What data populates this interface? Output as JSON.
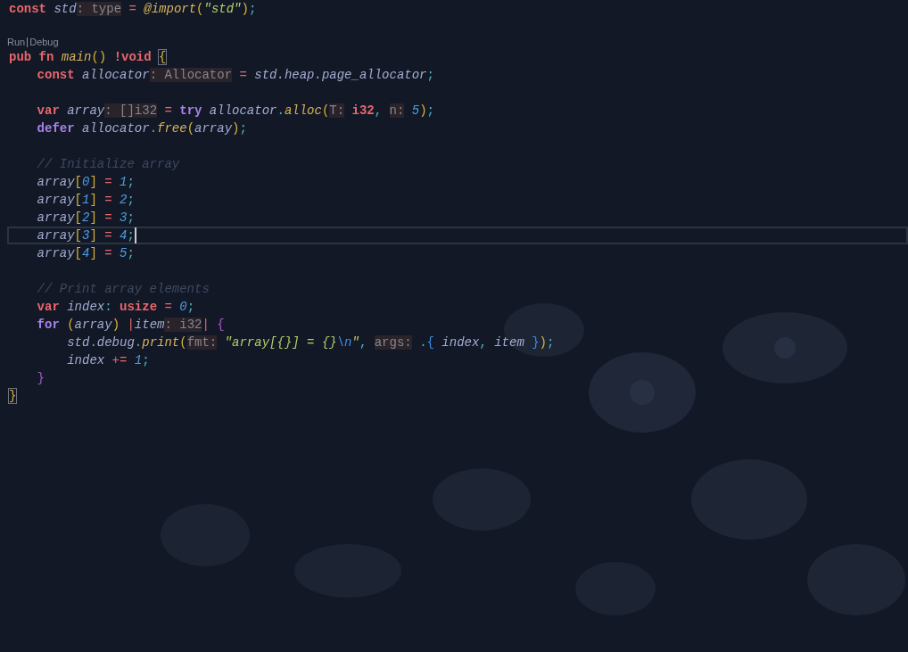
{
  "lines": [
    {
      "kind": "code",
      "current": false,
      "tokens": [
        {
          "kind": "kw",
          "text": "const "
        },
        {
          "kind": "var",
          "text": "std"
        },
        {
          "kind": "hint",
          "text": ": type"
        },
        {
          "kind": "op",
          "text": " = "
        },
        {
          "kind": "fn",
          "text": "@import"
        },
        {
          "kind": "br",
          "text": "("
        },
        {
          "kind": "str",
          "text": "\"std\""
        },
        {
          "kind": "br",
          "text": ")"
        },
        {
          "kind": "punct",
          "text": ";"
        }
      ]
    },
    {
      "kind": "blank"
    },
    {
      "kind": "codelens",
      "actions": [
        "Run",
        "Debug"
      ]
    },
    {
      "kind": "code",
      "current": false,
      "tokens": [
        {
          "kind": "kw",
          "text": "pub fn "
        },
        {
          "kind": "fn",
          "text": "main"
        },
        {
          "kind": "br",
          "text": "() "
        },
        {
          "kind": "kw",
          "text": "!void "
        },
        {
          "kind": "match",
          "text": "{"
        }
      ],
      "children": [
        {
          "kind": "code",
          "current": false,
          "tokens": [
            {
              "kind": "kw",
              "text": "const "
            },
            {
              "kind": "var",
              "text": "allocator"
            },
            {
              "kind": "hint",
              "text": ": Allocator"
            },
            {
              "kind": "op",
              "text": " = "
            },
            {
              "kind": "var",
              "text": "std.heap.page_allocator"
            },
            {
              "kind": "punct",
              "text": ";"
            }
          ]
        },
        {
          "kind": "blank"
        },
        {
          "kind": "code",
          "current": false,
          "tokens": [
            {
              "kind": "kw",
              "text": "var "
            },
            {
              "kind": "var",
              "text": "array"
            },
            {
              "kind": "hint",
              "text": ": []i32"
            },
            {
              "kind": "op",
              "text": " = "
            },
            {
              "kind": "ctrl",
              "text": "try "
            },
            {
              "kind": "var",
              "text": "allocator"
            },
            {
              "kind": "punct",
              "text": "."
            },
            {
              "kind": "fn",
              "text": "alloc"
            },
            {
              "kind": "br",
              "text": "("
            },
            {
              "kind": "hint",
              "text": "T:"
            },
            {
              "kind": "type",
              "text": " i32"
            },
            {
              "kind": "punct",
              "text": ", "
            },
            {
              "kind": "hint",
              "text": "n:"
            },
            {
              "kind": "num",
              "text": " 5"
            },
            {
              "kind": "br",
              "text": ")"
            },
            {
              "kind": "punct",
              "text": ";"
            }
          ]
        },
        {
          "kind": "code",
          "current": false,
          "tokens": [
            {
              "kind": "ctrl",
              "text": "defer "
            },
            {
              "kind": "var",
              "text": "allocator"
            },
            {
              "kind": "punct",
              "text": "."
            },
            {
              "kind": "fn",
              "text": "free"
            },
            {
              "kind": "br",
              "text": "("
            },
            {
              "kind": "var",
              "text": "array"
            },
            {
              "kind": "br",
              "text": ")"
            },
            {
              "kind": "punct",
              "text": ";"
            }
          ]
        },
        {
          "kind": "blank"
        },
        {
          "kind": "code",
          "current": false,
          "tokens": [
            {
              "kind": "comment",
              "text": "// Initialize array"
            }
          ]
        },
        {
          "kind": "code",
          "current": false,
          "tokens": [
            {
              "kind": "var",
              "text": "array"
            },
            {
              "kind": "br",
              "text": "["
            },
            {
              "kind": "num",
              "text": "0"
            },
            {
              "kind": "br",
              "text": "]"
            },
            {
              "kind": "op",
              "text": " = "
            },
            {
              "kind": "num",
              "text": "1"
            },
            {
              "kind": "punct",
              "text": ";"
            }
          ]
        },
        {
          "kind": "code",
          "current": false,
          "tokens": [
            {
              "kind": "var",
              "text": "array"
            },
            {
              "kind": "br",
              "text": "["
            },
            {
              "kind": "num",
              "text": "1"
            },
            {
              "kind": "br",
              "text": "]"
            },
            {
              "kind": "op",
              "text": " = "
            },
            {
              "kind": "num",
              "text": "2"
            },
            {
              "kind": "punct",
              "text": ";"
            }
          ]
        },
        {
          "kind": "code",
          "current": false,
          "tokens": [
            {
              "kind": "var",
              "text": "array"
            },
            {
              "kind": "br",
              "text": "["
            },
            {
              "kind": "num",
              "text": "2"
            },
            {
              "kind": "br",
              "text": "]"
            },
            {
              "kind": "op",
              "text": " = "
            },
            {
              "kind": "num",
              "text": "3"
            },
            {
              "kind": "punct",
              "text": ";"
            }
          ]
        },
        {
          "kind": "code",
          "current": true,
          "tokens": [
            {
              "kind": "var",
              "text": "array"
            },
            {
              "kind": "br",
              "text": "["
            },
            {
              "kind": "num",
              "text": "3"
            },
            {
              "kind": "br",
              "text": "]"
            },
            {
              "kind": "op",
              "text": " = "
            },
            {
              "kind": "num",
              "text": "4"
            },
            {
              "kind": "punct",
              "text": ";"
            }
          ]
        },
        {
          "kind": "code",
          "current": false,
          "tokens": [
            {
              "kind": "var",
              "text": "array"
            },
            {
              "kind": "br",
              "text": "["
            },
            {
              "kind": "num",
              "text": "4"
            },
            {
              "kind": "br",
              "text": "]"
            },
            {
              "kind": "op",
              "text": " = "
            },
            {
              "kind": "num",
              "text": "5"
            },
            {
              "kind": "punct",
              "text": ";"
            }
          ]
        },
        {
          "kind": "blank"
        },
        {
          "kind": "code",
          "current": false,
          "tokens": [
            {
              "kind": "comment",
              "text": "// Print array elements"
            }
          ]
        },
        {
          "kind": "code",
          "current": false,
          "tokens": [
            {
              "kind": "kw",
              "text": "var "
            },
            {
              "kind": "var",
              "text": "index"
            },
            {
              "kind": "punct",
              "text": ": "
            },
            {
              "kind": "type",
              "text": "usize"
            },
            {
              "kind": "op",
              "text": " = "
            },
            {
              "kind": "num",
              "text": "0"
            },
            {
              "kind": "punct",
              "text": ";"
            }
          ]
        },
        {
          "kind": "code",
          "current": false,
          "tokens": [
            {
              "kind": "ctrl",
              "text": "for "
            },
            {
              "kind": "br",
              "text": "("
            },
            {
              "kind": "var",
              "text": "array"
            },
            {
              "kind": "br",
              "text": ") "
            },
            {
              "kind": "op",
              "text": "|"
            },
            {
              "kind": "var",
              "text": "item"
            },
            {
              "kind": "hint",
              "text": ": i32"
            },
            {
              "kind": "op",
              "text": "| "
            },
            {
              "kind": "br2",
              "text": "{"
            }
          ],
          "children": [
            {
              "kind": "code",
              "current": false,
              "tokens": [
                {
                  "kind": "var",
                  "text": "std"
                },
                {
                  "kind": "punct",
                  "text": "."
                },
                {
                  "kind": "var",
                  "text": "debug"
                },
                {
                  "kind": "punct",
                  "text": "."
                },
                {
                  "kind": "fn",
                  "text": "print"
                },
                {
                  "kind": "br",
                  "text": "("
                },
                {
                  "kind": "hint",
                  "text": "fmt:"
                },
                {
                  "kind": "str",
                  "text": " \"array[{}] = {}"
                },
                {
                  "kind": "esc",
                  "text": "\\n"
                },
                {
                  "kind": "str",
                  "text": "\""
                },
                {
                  "kind": "punct",
                  "text": ", "
                },
                {
                  "kind": "hint",
                  "text": "args:"
                },
                {
                  "kind": "punct",
                  "text": " ."
                },
                {
                  "kind": "br3",
                  "text": "{ "
                },
                {
                  "kind": "var",
                  "text": "index"
                },
                {
                  "kind": "punct",
                  "text": ", "
                },
                {
                  "kind": "var",
                  "text": "item "
                },
                {
                  "kind": "br3",
                  "text": "}"
                },
                {
                  "kind": "br",
                  "text": ")"
                },
                {
                  "kind": "punct",
                  "text": ";"
                }
              ]
            },
            {
              "kind": "code",
              "current": false,
              "tokens": [
                {
                  "kind": "var",
                  "text": "index "
                },
                {
                  "kind": "op",
                  "text": "+= "
                },
                {
                  "kind": "num",
                  "text": "1"
                },
                {
                  "kind": "punct",
                  "text": ";"
                }
              ]
            }
          ]
        },
        {
          "kind": "code",
          "current": false,
          "tokens": [
            {
              "kind": "br2",
              "text": "}"
            }
          ]
        }
      ]
    },
    {
      "kind": "code",
      "current": false,
      "tokens": [
        {
          "kind": "match",
          "text": "}"
        }
      ]
    }
  ]
}
